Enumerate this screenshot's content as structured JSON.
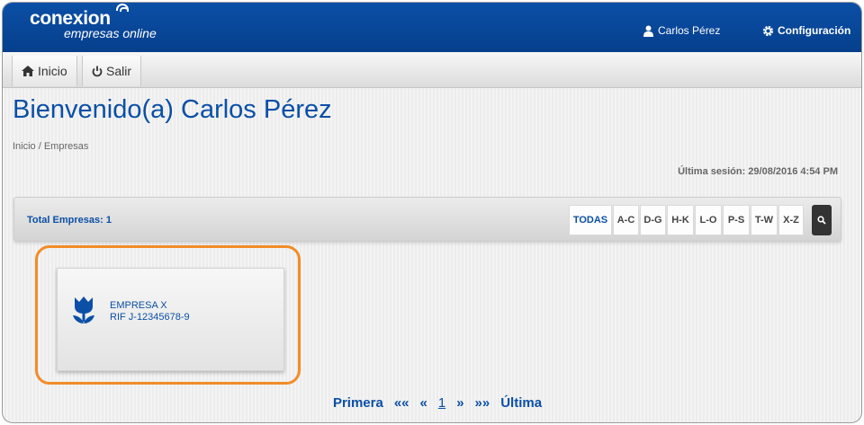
{
  "header": {
    "logo_main": "conexion",
    "logo_sub": "empresas online",
    "user_name": "Carlos Pérez",
    "config_label": "Configuración",
    "bg_color": "#0b4fa6"
  },
  "nav": {
    "home_label": "Inicio",
    "exit_label": "Salir"
  },
  "page": {
    "title": "Bienvenido(a) Carlos Pérez",
    "breadcrumb": "Inicio / Empresas",
    "last_session": "Última sesión: 29/08/2016 4:54 PM"
  },
  "filterbar": {
    "total_label": "Total Empresas: 1",
    "filters": [
      "TODAS",
      "A-C",
      "D-G",
      "H-K",
      "L-O",
      "P-S",
      "T-W",
      "X-Z"
    ],
    "active_filter": "TODAS"
  },
  "company": {
    "name": "EMPRESA X",
    "rif": "RIF J-12345678-9",
    "icon": "tulip-icon",
    "highlight_color": "#f28c28"
  },
  "pagination": {
    "first": "Primera",
    "prev_prev": "««",
    "prev": "«",
    "current": "1",
    "next": "»",
    "next_next": "»»",
    "last": "Última"
  }
}
